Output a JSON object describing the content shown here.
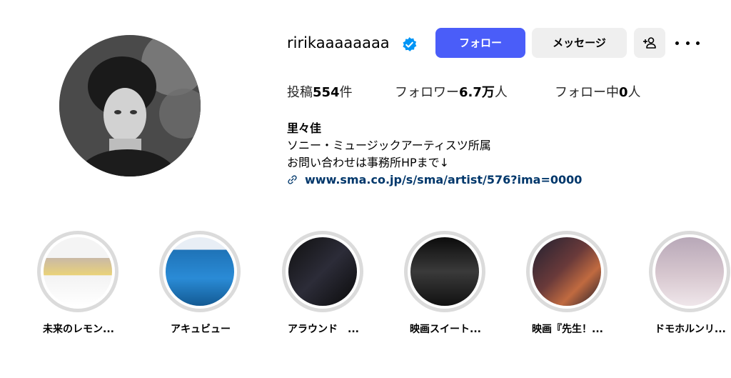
{
  "profile": {
    "username": "ririkaaaaaaaa",
    "verified": true,
    "accent_color": "#4a5df9",
    "link_color": "#00376b"
  },
  "actions": {
    "follow_label": "フォロー",
    "message_label": "メッセージ",
    "add_user_icon": "person-add-icon",
    "more_icon": "more-options-icon"
  },
  "stats": {
    "posts_prefix": "投稿",
    "posts_count": "554",
    "posts_suffix": "件",
    "followers_prefix": "フォロワー",
    "followers_count": "6.7万",
    "followers_suffix": "人",
    "following_prefix": "フォロー中",
    "following_count": "0",
    "following_suffix": "人"
  },
  "bio": {
    "name": "里々佳",
    "line1": "ソニー・ミュージックアーティスツ所属",
    "line2": "お問い合わせは事務所HPまで↓",
    "link": "www.sma.co.jp/s/sma/artist/576?ima=0000"
  },
  "highlights": [
    {
      "label": "未来のレモン..."
    },
    {
      "label": "アキュビュー"
    },
    {
      "label": "アラウンド　..."
    },
    {
      "label": "映画スイート..."
    },
    {
      "label": "映画『先生！..."
    },
    {
      "label": "ドモホルンリ..."
    }
  ]
}
